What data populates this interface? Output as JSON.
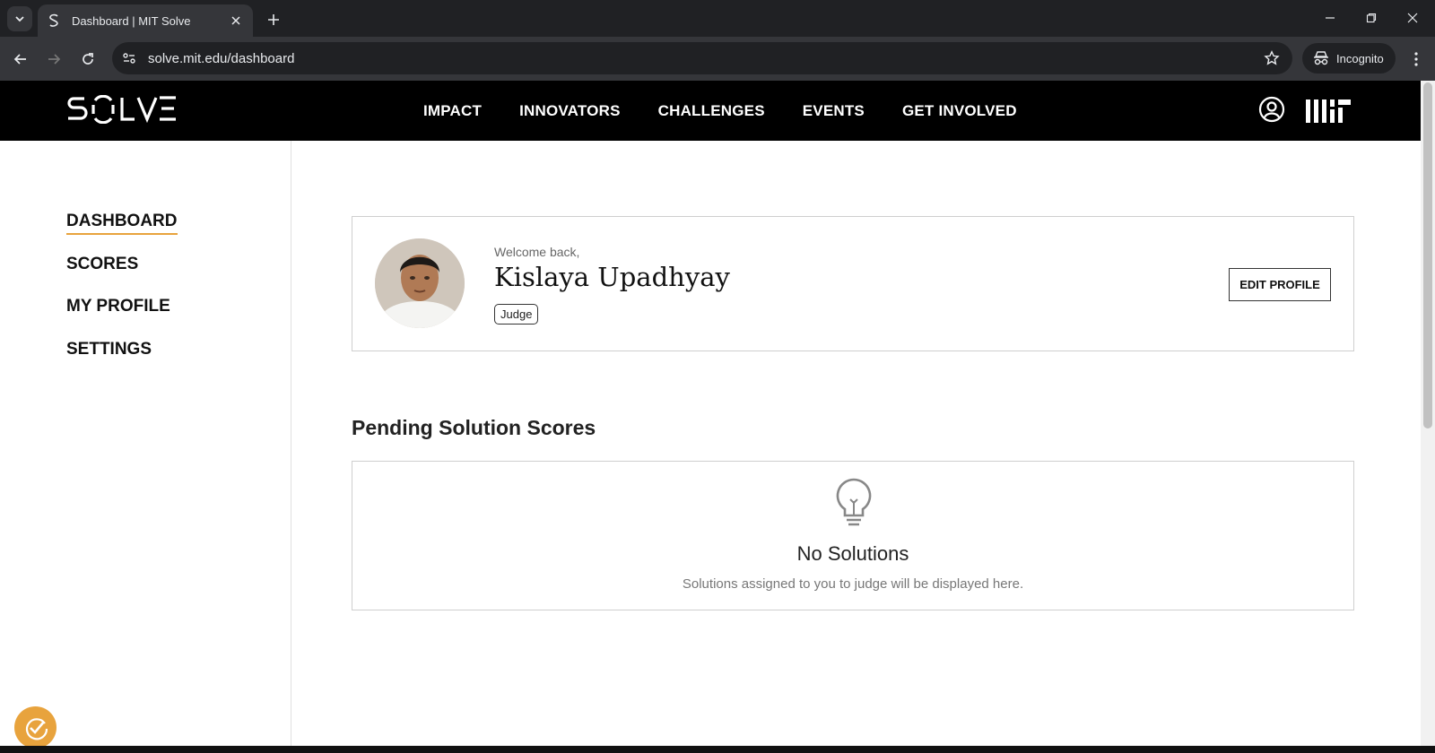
{
  "browser": {
    "tab_title": "Dashboard | MIT Solve",
    "url": "solve.mit.edu/dashboard",
    "incognito_label": "Incognito"
  },
  "site": {
    "logo_text": "SOLVE",
    "nav": [
      "IMPACT",
      "INNOVATORS",
      "CHALLENGES",
      "EVENTS",
      "GET INVOLVED"
    ]
  },
  "sidebar": {
    "items": [
      {
        "label": "DASHBOARD",
        "active": true
      },
      {
        "label": "SCORES",
        "active": false
      },
      {
        "label": "MY PROFILE",
        "active": false
      },
      {
        "label": "SETTINGS",
        "active": false
      }
    ]
  },
  "profile": {
    "welcome": "Welcome back,",
    "name": "Kislaya Upadhyay",
    "role": "Judge",
    "edit_label": "EDIT PROFILE"
  },
  "pending": {
    "title": "Pending Solution Scores",
    "empty_title": "No Solutions",
    "empty_text": "Solutions assigned to you to judge will be displayed here."
  },
  "colors": {
    "accent": "#e8a33d",
    "header_bg": "#000000"
  }
}
